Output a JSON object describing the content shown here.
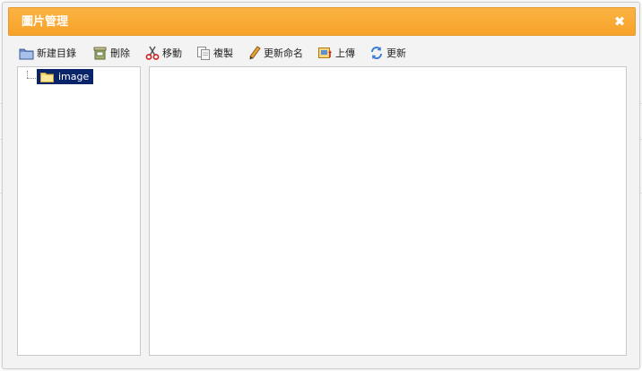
{
  "dialog": {
    "title": "圖片管理",
    "close_label": "✖"
  },
  "toolbar": {
    "new_folder": "新建目錄",
    "delete": "刪除",
    "move": "移動",
    "copy": "複製",
    "rename": "更新命名",
    "upload": "上傳",
    "refresh": "更新"
  },
  "tree": {
    "root_label": "image",
    "root_selected": true
  },
  "icons": {
    "new_folder": "folder-icon",
    "delete": "trash-icon",
    "move": "scissors-icon",
    "copy": "copy-icon",
    "rename": "pencil-icon",
    "upload": "upload-icon",
    "refresh": "refresh-icon",
    "tree_node": "folder-icon"
  },
  "colors": {
    "titlebar": "#f7a22a",
    "selection": "#0a246a"
  }
}
